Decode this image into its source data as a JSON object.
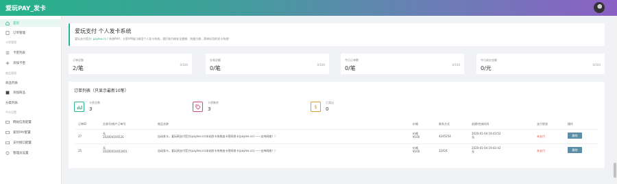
{
  "header": {
    "brand": "爱玩PAY_发卡"
  },
  "sidebar": {
    "items": [
      {
        "label": "首页",
        "icon": "home-icon",
        "active": true
      },
      {
        "label": "订单管理",
        "icon": "orders-icon"
      },
      {
        "label": "卡密列表",
        "icon": "list-icon"
      },
      {
        "label": "添加卡密",
        "icon": "add-icon"
      },
      {
        "label": "商品列表",
        "icon": "goods-icon"
      },
      {
        "label": "添加商品",
        "icon": "add-goods-icon"
      },
      {
        "label": "分类列表",
        "icon": "category-icon"
      },
      {
        "label": "网站信息配置",
        "icon": "site-icon"
      },
      {
        "label": "爱玩PAY配置",
        "icon": "pay-icon"
      },
      {
        "label": "支付接口配置",
        "icon": "api-icon"
      },
      {
        "label": "管理员设置",
        "icon": "admin-icon"
      }
    ],
    "heads": [
      "卡密管理",
      "商品管理",
      "平台设置"
    ]
  },
  "hero": {
    "title": "爱玩支付 个人发卡系统",
    "sub_prefix": "爱玩支付官方:",
    "sub_link": "paylee.cn",
    "sub_rest": "/ 系统PHP，卡密API接口调用个人发卡系统，我们致力做安全便捷、快捷方便，简单好用的发卡系统!"
  },
  "stats": [
    {
      "label": "订单总数",
      "value": "2/笔",
      "ratio": "0/100"
    },
    {
      "label": "交易总额",
      "value": "0/笔",
      "ratio": "0/100"
    },
    {
      "label": "今日订单数",
      "value": "0/笔",
      "ratio": "0/100"
    },
    {
      "label": "今日成交金额",
      "value": "0/元",
      "ratio": "0/100"
    }
  ],
  "orders": {
    "title": "订单列表（只显示最新10笔）",
    "metrics": [
      {
        "label": "卡密总数",
        "value": "3",
        "icon": "bar-chart-icon",
        "color": "#26b28a"
      },
      {
        "label": "卡密剩余",
        "value": "3",
        "icon": "tag-icon",
        "color": "#d9467a"
      },
      {
        "label": "已卖出",
        "value": "0",
        "icon": "dollar-icon",
        "color": "#e0a030"
      }
    ],
    "columns": [
      "订单ID",
      "交易号/商户订单号",
      "商品名称",
      "价格",
      "联系方式",
      "创建/完成时间",
      "支付状态",
      "操作"
    ],
    "rows": [
      {
        "id": "27",
        "trade_no": "无",
        "order_no": "20200410452S",
        "goods": "自动发卡，爱玩网支付官方(paylee.cn)本站秒卡系统由卡密网发卡(paylee.cn) ——支持网络！）",
        "price_line1": "价格",
        "price_line2": "¥100",
        "contact": "4245254",
        "time_line1": "2020-01-04 19:43:52",
        "time_line2": "无",
        "status": "未支付",
        "action": "删除"
      },
      {
        "id": "25",
        "trade_no": "无",
        "order_no": "20200410452401",
        "goods": "自动发卡，爱玩网支付官方(paylee.cn)本站秒卡系统由卡密网发卡(paylee.cn) ——支持网络！）",
        "price_line1": "价格",
        "price_line2": "¥100",
        "contact": "22424",
        "time_line1": "2020-01-04 19:42:42",
        "time_line2": "无",
        "status": "未支付",
        "action": "删除"
      }
    ]
  },
  "colors": {
    "accent": "#26b28a",
    "danger": "#e74c3c",
    "button": "#5b8ea6"
  }
}
